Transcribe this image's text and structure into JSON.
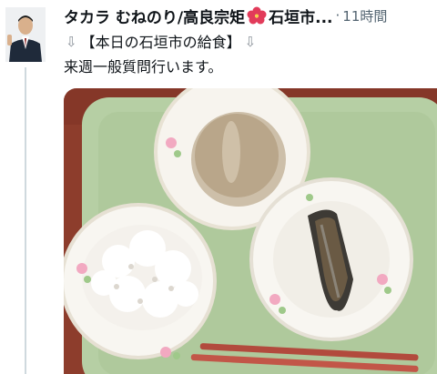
{
  "tweet": {
    "author_name": "タカラ むねのり/高良宗矩",
    "author_name_tail": "石垣市...",
    "dot": "·",
    "time": "11時間",
    "line1_pre_arrow": "⇩",
    "line1_text": "【本日の石垣市の給食】",
    "line1_post_arrow": "⇩",
    "line2_text": "来週一般質問行います。"
  },
  "icons": {
    "flag": "hibiscus-icon",
    "arrow": "down-arrow-icon"
  },
  "colors": {
    "tray": "#b6cfa4",
    "bowl": "#f7f4ee",
    "table": "#8d3d2c"
  }
}
